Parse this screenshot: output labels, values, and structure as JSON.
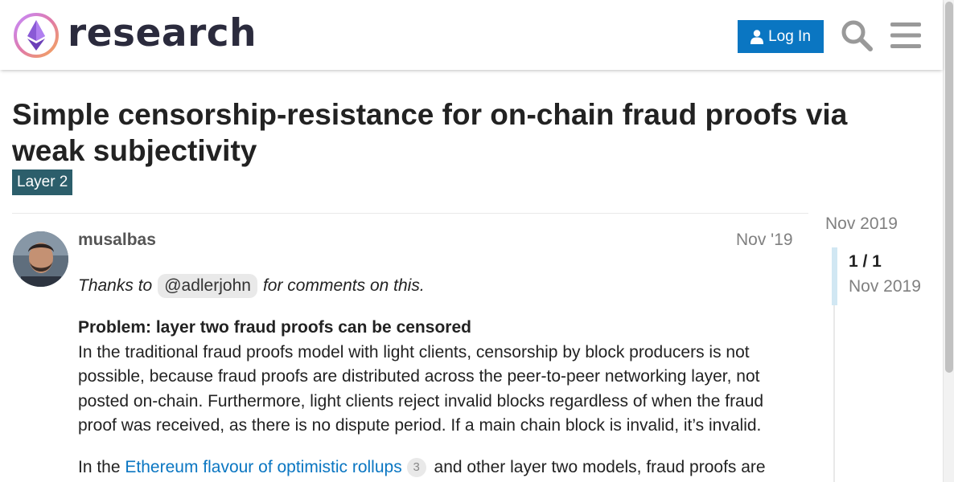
{
  "header": {
    "logo_text": "research",
    "login_label": "Log In",
    "icons": [
      "logo-icon",
      "user-icon",
      "search-icon",
      "menu-icon"
    ]
  },
  "topic": {
    "title": "Simple censorship-resistance for on-chain fraud proofs via weak subjectivity",
    "category": "Layer 2"
  },
  "post": {
    "username": "musalbas",
    "date": "Nov '19",
    "intro_before": "Thanks to",
    "mention": "@adlerjohn",
    "intro_after": "for comments on this.",
    "problem_heading": "Problem: layer two fraud proofs can be censored",
    "paragraph1": "In the traditional fraud proofs model with light clients, censorship by block producers is not possible, because fraud proofs are distributed across the peer-to-peer networking layer, not posted on-chain. Furthermore, light clients reject invalid blocks regardless of when the fraud proof was received, as there is no dispute period. If a main chain block is invalid, it’s invalid.",
    "paragraph2_before": "In the",
    "paragraph2_link": "Ethereum flavour of optimistic rollups",
    "paragraph2_link_count": "3",
    "paragraph2_after": "and other layer two models, fraud proofs are"
  },
  "timeline": {
    "top_date": "Nov 2019",
    "position": "1 / 1",
    "bottom_date": "Nov 2019"
  },
  "colors": {
    "accent": "#0a76c2",
    "category_bg": "#2c5e6b",
    "muted_text": "#808080"
  }
}
